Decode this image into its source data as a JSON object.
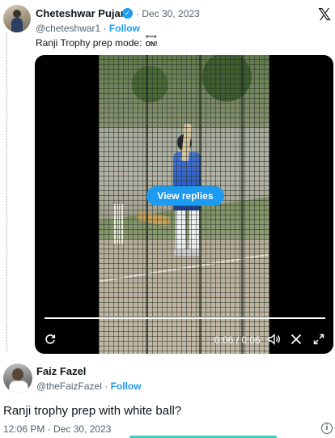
{
  "quoted_tweet": {
    "author_name": "Cheteshwar Pujara",
    "verified_symbol": "✓",
    "date": "· Dec 30, 2023",
    "handle": "@cheteshwar1",
    "separator": " · ",
    "follow_label": "Follow",
    "text": "Ranji Trophy prep mode:",
    "emoji": {
      "arrows": "⇐⇒",
      "label": "ON!"
    },
    "x_logo": "𝕏"
  },
  "video": {
    "view_replies_label": "View replies",
    "current_time": "0:06",
    "duration": "0:06",
    "time_display": "0:06 / 0:06",
    "progress": 1.0,
    "icons": [
      "replay-icon",
      "volume-icon",
      "x-logo-icon",
      "fullscreen-icon"
    ]
  },
  "reply": {
    "author_name": "Faiz Fazel",
    "handle": "@theFaizFazel",
    "separator": " · ",
    "follow_label": "Follow",
    "text": "Ranji trophy prep with white ball?",
    "timestamp": "12:06 PM · Dec 30, 2023",
    "info_symbol": "i"
  },
  "colors": {
    "accent": "#1d9bf0",
    "text_primary": "#0f1419",
    "text_secondary": "#536471",
    "bottom_bar": "#3ed1c4"
  }
}
